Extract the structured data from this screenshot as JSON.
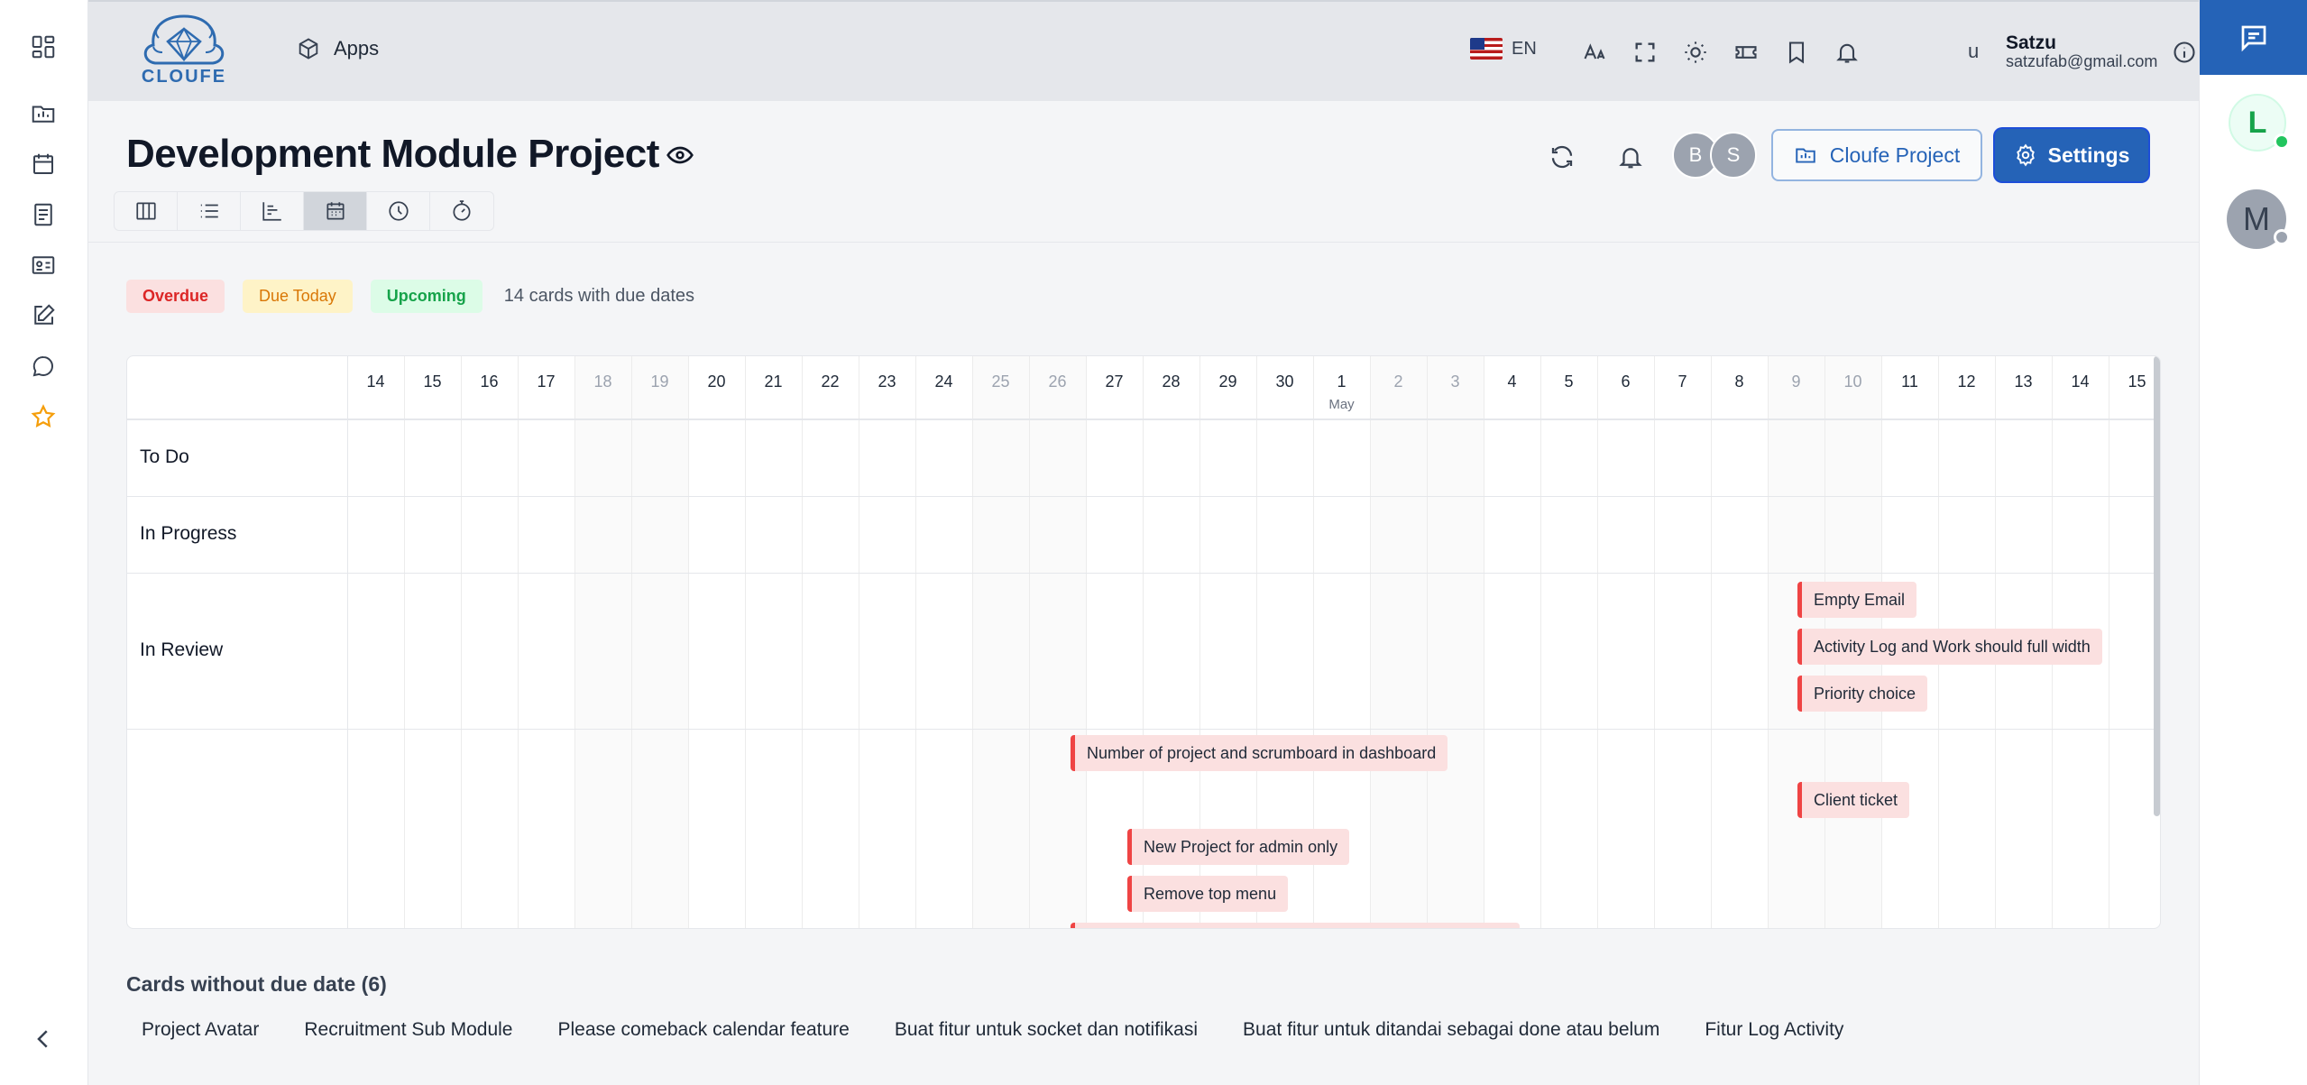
{
  "topbar": {
    "logo_text": "CLOUFE",
    "apps_label": "Apps",
    "language": "EN",
    "user_initial": "u",
    "user_name": "Satzu",
    "user_email": "satzufab@gmail.com"
  },
  "header": {
    "title": "Development Module Project",
    "members": [
      "B",
      "S"
    ],
    "project_button": "Cloufe Project",
    "settings_button": "Settings"
  },
  "legend": {
    "overdue": "Overdue",
    "due_today": "Due Today",
    "upcoming": "Upcoming",
    "count_text": "14 cards with due dates",
    "colors": {
      "overdue_bg": "#fbe0e0",
      "overdue_text": "#dc2626",
      "due_today_bg": "#fef3c7",
      "due_today_text": "#d97706",
      "upcoming_bg": "#dcfce7",
      "upcoming_text": "#16a34a"
    }
  },
  "calendar": {
    "days": [
      {
        "d": "14",
        "weekend": false
      },
      {
        "d": "15",
        "weekend": false
      },
      {
        "d": "16",
        "weekend": false
      },
      {
        "d": "17",
        "weekend": false
      },
      {
        "d": "18",
        "weekend": true
      },
      {
        "d": "19",
        "weekend": true
      },
      {
        "d": "20",
        "weekend": false
      },
      {
        "d": "21",
        "weekend": false
      },
      {
        "d": "22",
        "weekend": false
      },
      {
        "d": "23",
        "weekend": false
      },
      {
        "d": "24",
        "weekend": false
      },
      {
        "d": "25",
        "weekend": true
      },
      {
        "d": "26",
        "weekend": true
      },
      {
        "d": "27",
        "weekend": false
      },
      {
        "d": "28",
        "weekend": false
      },
      {
        "d": "29",
        "weekend": false
      },
      {
        "d": "30",
        "weekend": false
      },
      {
        "d": "1",
        "weekend": false,
        "month": "May"
      },
      {
        "d": "2",
        "weekend": true
      },
      {
        "d": "3",
        "weekend": true
      },
      {
        "d": "4",
        "weekend": false
      },
      {
        "d": "5",
        "weekend": false
      },
      {
        "d": "6",
        "weekend": false
      },
      {
        "d": "7",
        "weekend": false
      },
      {
        "d": "8",
        "weekend": false
      },
      {
        "d": "9",
        "weekend": true
      },
      {
        "d": "10",
        "weekend": true
      },
      {
        "d": "11",
        "weekend": false
      },
      {
        "d": "12",
        "weekend": false
      },
      {
        "d": "13",
        "weekend": false
      },
      {
        "d": "14",
        "weekend": false
      },
      {
        "d": "15",
        "weekend": false
      }
    ],
    "rows": [
      "To Do",
      "In Progress",
      "In Review"
    ],
    "tasks": [
      {
        "label": "Empty Email",
        "start": "10",
        "status": "overdue"
      },
      {
        "label": "Activity Log and Work should full width",
        "start": "10",
        "status": "overdue"
      },
      {
        "label": "Priority choice",
        "start": "10",
        "status": "overdue"
      },
      {
        "label": "Number of project and scrumboard in dashboard",
        "start": "28",
        "status": "overdue"
      },
      {
        "label": "Client ticket",
        "start": "10",
        "status": "overdue"
      },
      {
        "label": "New Project for admin only",
        "start": "29",
        "status": "overdue"
      },
      {
        "label": "Remove top menu",
        "start": "29",
        "status": "overdue"
      },
      {
        "label": "",
        "start": "28",
        "status": "overdue"
      }
    ]
  },
  "no_due": {
    "title": "Cards without due date (6)",
    "items": [
      "Project Avatar",
      "Recruitment Sub Module",
      "Please comeback calendar feature",
      "Buat fitur untuk socket dan notifikasi",
      "Buat fitur untuk ditandai sebagai done atau belum",
      "Fitur Log Activity"
    ]
  },
  "right_col": {
    "avatar_l": "L",
    "avatar_m": "M"
  }
}
